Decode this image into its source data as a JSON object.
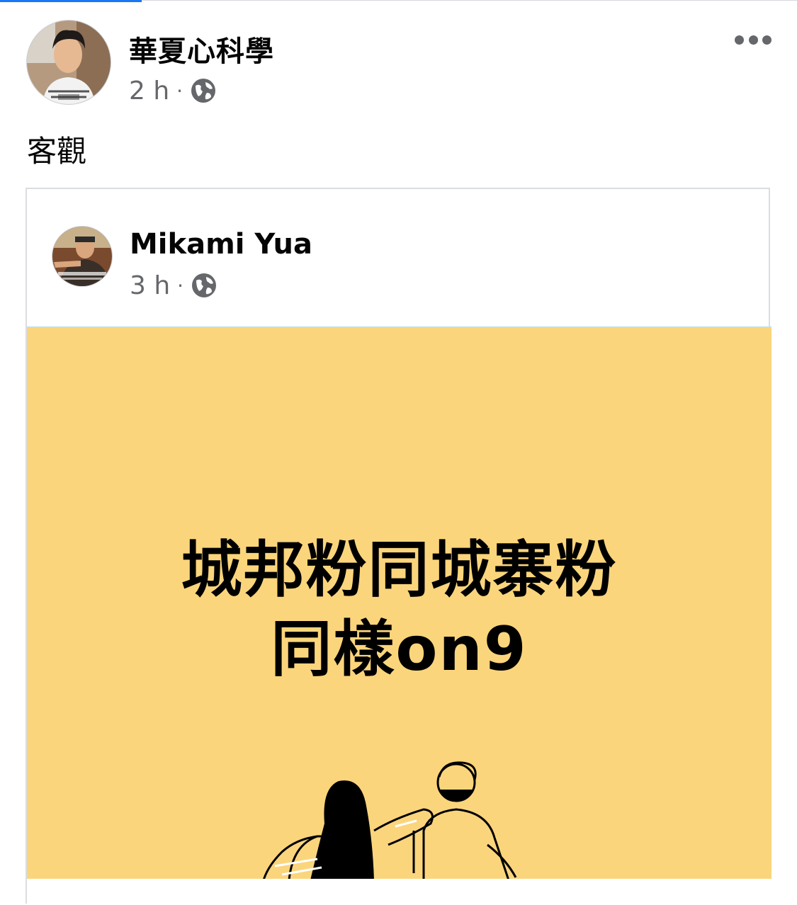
{
  "post": {
    "author": "華夏心科學",
    "time": "2 h",
    "separator": "·",
    "privacy_icon": "globe-icon",
    "more_icon": "more-horizontal-icon",
    "text": "客觀"
  },
  "shared_post": {
    "author": "Mikami Yua",
    "time": "3 h",
    "separator": "·",
    "privacy_icon": "globe-icon",
    "image": {
      "line1": "城邦粉同城寨粉",
      "line2": "同樣on9",
      "background_color": "#fbd57c"
    }
  }
}
